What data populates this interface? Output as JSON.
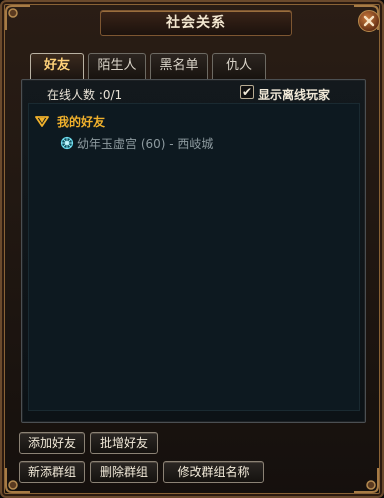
{
  "window": {
    "title": "社会关系"
  },
  "tabs": [
    {
      "label": "好友",
      "active": true
    },
    {
      "label": "陌生人",
      "active": false
    },
    {
      "label": "黑名单",
      "active": false
    },
    {
      "label": "仇人",
      "active": false
    }
  ],
  "panel": {
    "online_count": "在线人数 :0/1",
    "show_offline": {
      "label": "显示离线玩家",
      "checked": true,
      "mark": "✔"
    }
  },
  "groups": [
    {
      "name": "我的好友",
      "members": [
        {
          "text": "幼年玉虚宫 (60) - 西岐城"
        }
      ]
    }
  ],
  "buttons": {
    "add_friend": "添加好友",
    "batch_add_friend": "批增好友",
    "new_group": "新添群组",
    "delete_group": "删除群组",
    "rename_group": "修改群组名称"
  },
  "colors": {
    "accent_gold": "#f0b12c",
    "text_light": "#f1e9d8",
    "panel_bg": "#0d1920"
  },
  "icons": [
    "close-icon",
    "group-expand-icon",
    "player-online-icon",
    "corner-ornament-icon"
  ]
}
